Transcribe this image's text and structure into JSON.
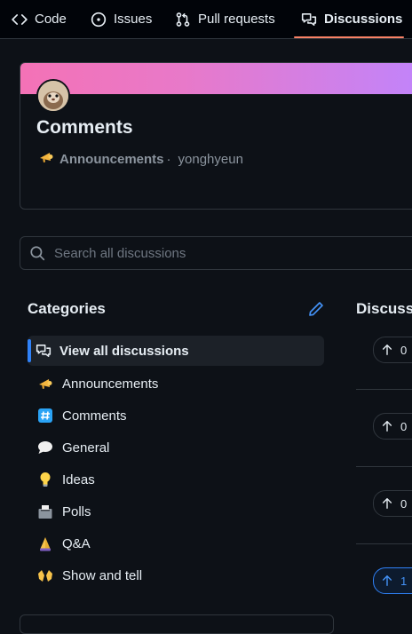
{
  "nav": {
    "tabs": [
      {
        "label": "Code",
        "icon": "code-icon"
      },
      {
        "label": "Issues",
        "icon": "issue-icon"
      },
      {
        "label": "Pull requests",
        "icon": "pull-request-icon"
      },
      {
        "label": "Discussions",
        "icon": "discussion-icon",
        "active": true
      }
    ]
  },
  "header": {
    "title": "Comments",
    "category": "Announcements",
    "separator": "·",
    "author": "yonghyeun"
  },
  "search": {
    "placeholder": "Search all discussions"
  },
  "categories": {
    "heading": "Categories",
    "items": [
      {
        "label": "View all discussions",
        "icon": "discussion-icon",
        "active": true
      },
      {
        "label": "Announcements",
        "icon": "megaphone-emoji"
      },
      {
        "label": "Comments",
        "icon": "hash-emoji"
      },
      {
        "label": "General",
        "icon": "speech-bubble-emoji"
      },
      {
        "label": "Ideas",
        "icon": "lightbulb-emoji"
      },
      {
        "label": "Polls",
        "icon": "ballot-box-emoji"
      },
      {
        "label": "Q&A",
        "icon": "praying-hands-emoji"
      },
      {
        "label": "Show and tell",
        "icon": "raising-hands-emoji"
      }
    ]
  },
  "discussions": {
    "heading": "Discussi",
    "votes": [
      "0",
      "0",
      "0",
      "1"
    ]
  },
  "colors": {
    "accent": "#2f81f7",
    "tab_underline": "#f78166",
    "background": "#0d1117"
  }
}
